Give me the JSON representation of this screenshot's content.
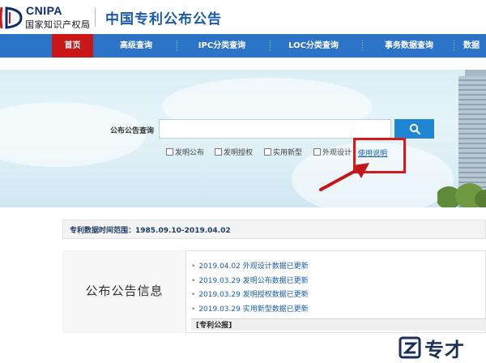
{
  "header": {
    "logo_en": "CNIPA",
    "logo_cn": "国家知识产权局",
    "site_title": "中国专利公布公告"
  },
  "nav": {
    "items": [
      {
        "label": "首页",
        "active": true
      },
      {
        "label": "高级查询"
      },
      {
        "label": "IPC分类查询"
      },
      {
        "label": "LOC分类查询"
      },
      {
        "label": "事务数据查询"
      },
      {
        "label": "数据"
      }
    ]
  },
  "search": {
    "label": "公布公告查询",
    "value": "",
    "placeholder": "",
    "button_icon": "search-icon",
    "checkboxes": [
      {
        "label": "发明公布",
        "checked": false
      },
      {
        "label": "发明授权",
        "checked": false
      },
      {
        "label": "实用新型",
        "checked": false
      },
      {
        "label": "外观设计",
        "checked": false
      }
    ],
    "help_link": "使用说明"
  },
  "range": {
    "text": "专利数据时间范围：1985.09.10-2019.04.02"
  },
  "info": {
    "title": "公布公告信息",
    "news": [
      {
        "date": "2019.04.02",
        "text": "外观设计数据已更新"
      },
      {
        "date": "2019.03.29",
        "text": "发明公布数据已更新"
      },
      {
        "date": "2019.03.29",
        "text": "发明授权数据已更新"
      },
      {
        "date": "2019.03.29",
        "text": "实用新型数据已更新"
      }
    ],
    "tab_label": "[专利公报]"
  },
  "watermark": {
    "text": "专才"
  },
  "colors": {
    "nav_bg": "#2c74c7",
    "nav_active": "#c91717",
    "accent_blue": "#1a5aa8",
    "highlight_red": "#d41a1a"
  }
}
